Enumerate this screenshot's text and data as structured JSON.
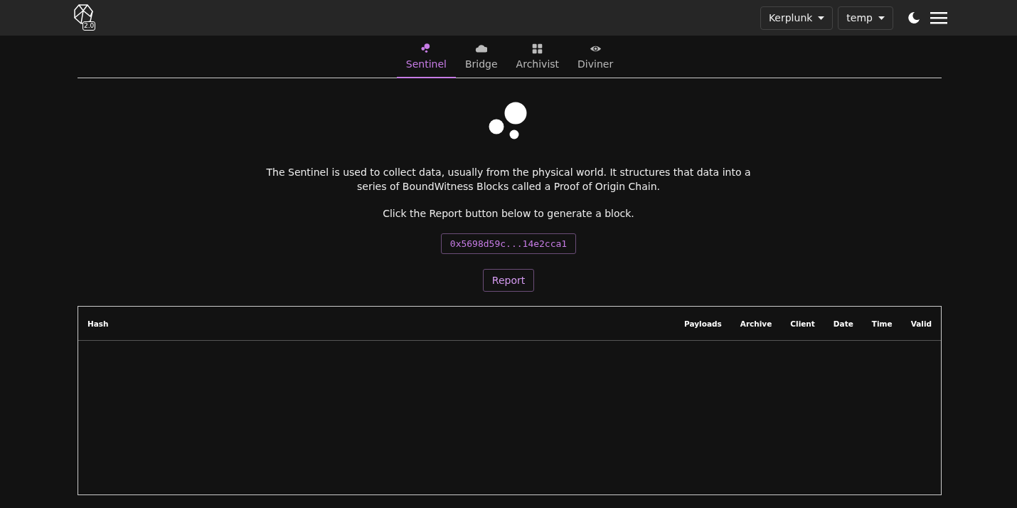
{
  "header": {
    "logo_badge": "2.0",
    "selectors": [
      {
        "label": "Kerplunk"
      },
      {
        "label": "temp"
      }
    ]
  },
  "tabs": [
    {
      "label": "Sentinel",
      "kind": "dots",
      "selected": true
    },
    {
      "label": "Bridge",
      "kind": "cloud",
      "selected": false
    },
    {
      "label": "Archivist",
      "kind": "grid",
      "selected": false
    },
    {
      "label": "Diviner",
      "kind": "eye",
      "selected": false
    }
  ],
  "description": "The Sentinel is used to collect data, usually from the physical world. It structures that data into a series of BoundWitness Blocks called a Proof of Origin Chain.",
  "instruction": "Click the Report button below to generate a block.",
  "address": "0x5698d59c...14e2cca1",
  "report_button": "Report",
  "table": {
    "columns": [
      "Hash",
      "Payloads",
      "Archive",
      "Client",
      "Date",
      "Time",
      "Valid"
    ]
  }
}
